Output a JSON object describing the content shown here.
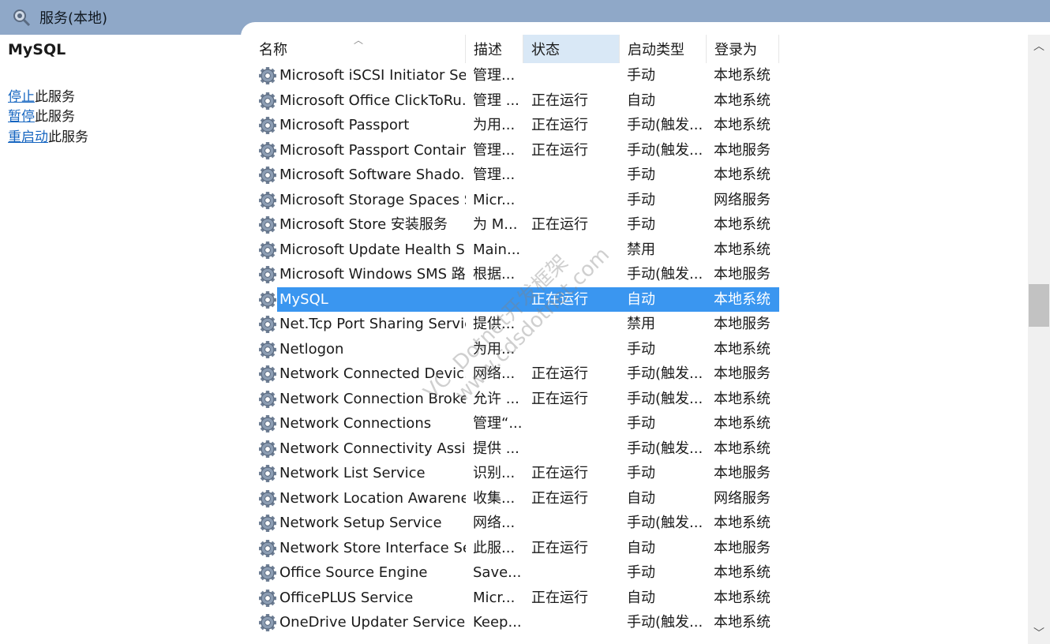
{
  "window": {
    "title": "服务(本地)"
  },
  "left_panel": {
    "service_name": "MySQL",
    "actions": [
      {
        "link": "停止",
        "suffix": "此服务"
      },
      {
        "link": "暂停",
        "suffix": "此服务"
      },
      {
        "link": "重启动",
        "suffix": "此服务"
      }
    ]
  },
  "columns": [
    "名称",
    "描述",
    "状态",
    "启动类型",
    "登录为"
  ],
  "sorted_column": 2,
  "rows": [
    {
      "name": "Microsoft iSCSI Initiator Ser...",
      "desc": "管理...",
      "status": "",
      "startup": "手动",
      "logon": "本地系统"
    },
    {
      "name": "Microsoft Office ClickToRu...",
      "desc": "管理 ...",
      "status": "正在运行",
      "startup": "自动",
      "logon": "本地系统"
    },
    {
      "name": "Microsoft Passport",
      "desc": "为用...",
      "status": "正在运行",
      "startup": "手动(触发...",
      "logon": "本地系统"
    },
    {
      "name": "Microsoft Passport Container",
      "desc": "管理...",
      "status": "正在运行",
      "startup": "手动(触发...",
      "logon": "本地服务"
    },
    {
      "name": "Microsoft Software Shado...",
      "desc": "管理...",
      "status": "",
      "startup": "手动",
      "logon": "本地系统"
    },
    {
      "name": "Microsoft Storage Spaces S...",
      "desc": "Micr...",
      "status": "",
      "startup": "手动",
      "logon": "网络服务"
    },
    {
      "name": "Microsoft Store 安装服务",
      "desc": "为 M...",
      "status": "正在运行",
      "startup": "手动",
      "logon": "本地系统"
    },
    {
      "name": "Microsoft Update Health S...",
      "desc": "Main...",
      "status": "",
      "startup": "禁用",
      "logon": "本地系统"
    },
    {
      "name": "Microsoft Windows SMS 路...",
      "desc": "根据...",
      "status": "",
      "startup": "手动(触发...",
      "logon": "本地服务"
    },
    {
      "name": "MySQL",
      "desc": "",
      "status": "正在运行",
      "startup": "自动",
      "logon": "本地系统",
      "selected": true
    },
    {
      "name": "Net.Tcp Port Sharing Service",
      "desc": "提供...",
      "status": "",
      "startup": "禁用",
      "logon": "本地服务"
    },
    {
      "name": "Netlogon",
      "desc": "为用...",
      "status": "",
      "startup": "手动",
      "logon": "本地系统"
    },
    {
      "name": "Network Connected Devic...",
      "desc": "网络...",
      "status": "正在运行",
      "startup": "手动(触发...",
      "logon": "本地服务"
    },
    {
      "name": "Network Connection Broker",
      "desc": "允许 ...",
      "status": "正在运行",
      "startup": "手动(触发...",
      "logon": "本地系统"
    },
    {
      "name": "Network Connections",
      "desc": "管理“...",
      "status": "",
      "startup": "手动",
      "logon": "本地系统"
    },
    {
      "name": "Network Connectivity Assis...",
      "desc": "提供 ...",
      "status": "",
      "startup": "手动(触发...",
      "logon": "本地系统"
    },
    {
      "name": "Network List Service",
      "desc": "识别...",
      "status": "正在运行",
      "startup": "手动",
      "logon": "本地服务"
    },
    {
      "name": "Network Location Awarene...",
      "desc": "收集...",
      "status": "正在运行",
      "startup": "自动",
      "logon": "网络服务"
    },
    {
      "name": "Network Setup Service",
      "desc": "网络...",
      "status": "",
      "startup": "手动(触发...",
      "logon": "本地系统"
    },
    {
      "name": "Network Store Interface Se...",
      "desc": "此服...",
      "status": "正在运行",
      "startup": "自动",
      "logon": "本地服务"
    },
    {
      "name": "Office  Source Engine",
      "desc": "Save...",
      "status": "",
      "startup": "手动",
      "logon": "本地系统"
    },
    {
      "name": "OfficePLUS Service",
      "desc": "Micr...",
      "status": "正在运行",
      "startup": "自动",
      "logon": "本地系统"
    },
    {
      "name": "OneDrive Updater Service",
      "desc": "Keep...",
      "status": "",
      "startup": "手动(触发...",
      "logon": "本地系统"
    }
  ],
  "watermark": {
    "line1": "VC .Dotnet开发框架",
    "line2": "www.cdsdotnet.com"
  },
  "colors": {
    "header_band": "#8fa8c8",
    "selection": "#3a96f0",
    "link": "#1565c0",
    "sorted_header": "#d9e8f6"
  },
  "icons": {
    "row": "gear-icon",
    "title": "gear-search-icon"
  }
}
